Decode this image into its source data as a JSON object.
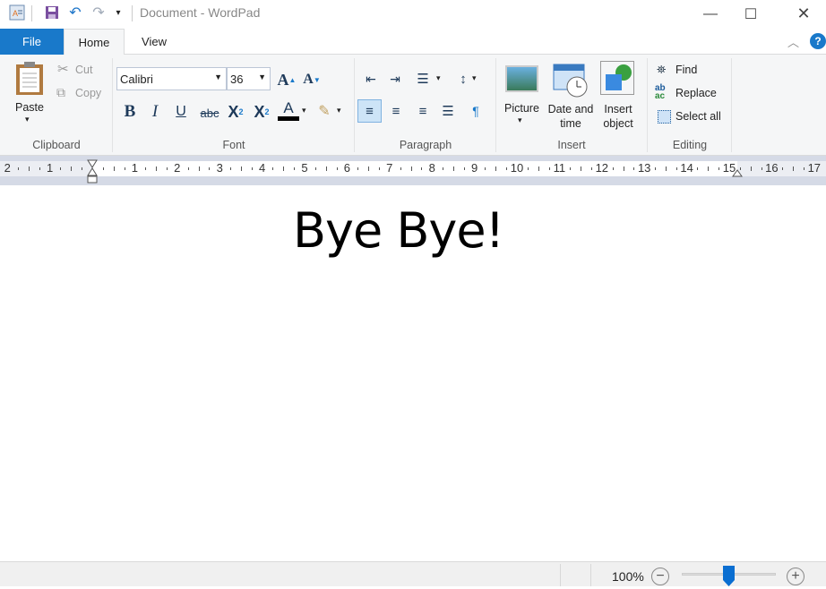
{
  "window": {
    "title": "Document - WordPad"
  },
  "tabs": [
    {
      "label": "File"
    },
    {
      "label": "Home"
    },
    {
      "label": "View"
    }
  ],
  "clipboard": {
    "label": "Clipboard",
    "paste": "Paste",
    "cut": "Cut",
    "copy": "Copy"
  },
  "font": {
    "label": "Font",
    "family": "Calibri",
    "size": "36"
  },
  "paragraph": {
    "label": "Paragraph"
  },
  "insert": {
    "label": "Insert",
    "picture": "Picture",
    "date_time_1": "Date and",
    "date_time_2": "time",
    "object_1": "Insert",
    "object_2": "object"
  },
  "editing": {
    "label": "Editing",
    "find": "Find",
    "replace": "Replace",
    "select_all": "Select all"
  },
  "ruler": {
    "labels": [
      "2",
      "1",
      "1",
      "2",
      "3",
      "4",
      "5",
      "6",
      "7",
      "8",
      "9",
      "10",
      "11",
      "12",
      "13",
      "14",
      "15",
      "16",
      "17"
    ]
  },
  "document": {
    "text": "Bye Bye!"
  },
  "status": {
    "zoom": "100%",
    "zoom_percent": 100
  }
}
